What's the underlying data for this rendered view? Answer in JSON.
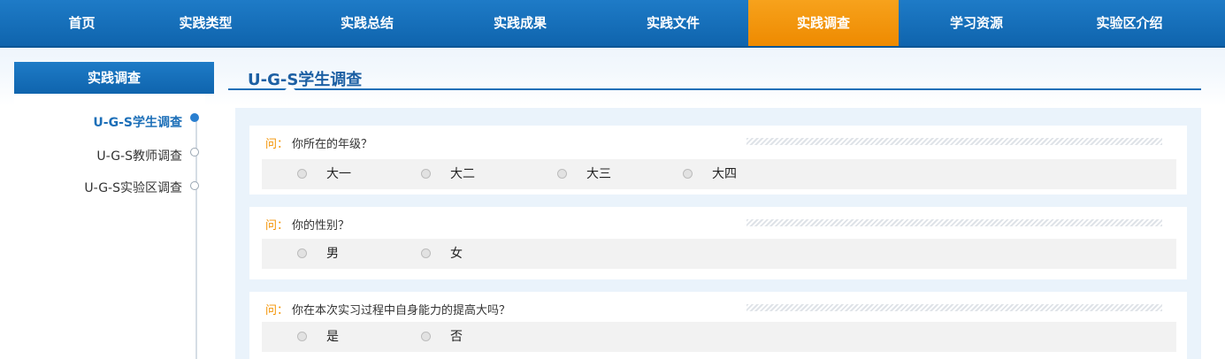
{
  "nav": {
    "items": [
      {
        "label": "首页"
      },
      {
        "label": "实践类型"
      },
      {
        "label": "实践总结"
      },
      {
        "label": "实践成果"
      },
      {
        "label": "实践文件"
      },
      {
        "label": "实践调查",
        "active": true
      },
      {
        "label": "学习资源"
      },
      {
        "label": "实验区介绍"
      }
    ],
    "active_color": "#f39200",
    "bar_color": "#1469b4"
  },
  "sidebar": {
    "title": "实践调查",
    "items": [
      {
        "label": "U-G-S学生调查",
        "active": true
      },
      {
        "label": "U-G-S教师调查"
      },
      {
        "label": "U-G-S实验区调查"
      }
    ]
  },
  "content": {
    "title": "U-G-S学生调查",
    "question_prefix": "问：",
    "questions": [
      {
        "text": "你所在的年级？",
        "options": [
          "大一",
          "大二",
          "大三",
          "大四"
        ]
      },
      {
        "text": "你的性别？",
        "options": [
          "男",
          "女"
        ]
      },
      {
        "text": "你在本次实习过程中自身能力的提高大吗？",
        "options": [
          "是",
          "否"
        ]
      }
    ]
  }
}
